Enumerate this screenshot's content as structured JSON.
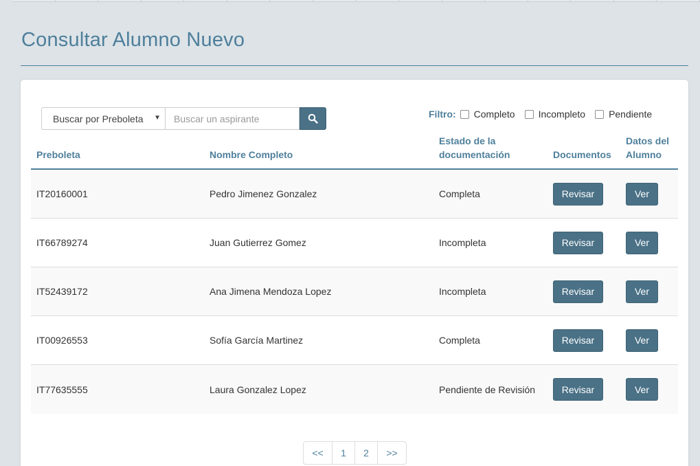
{
  "page": {
    "title": "Consultar Alumno Nuevo"
  },
  "search": {
    "select_value": "Buscar por Preboleta",
    "placeholder": "Buscar un aspirante",
    "button_icon": "search-icon"
  },
  "filter": {
    "label": "Filtro:",
    "options": [
      "Completo",
      "Incompleto",
      "Pendiente"
    ]
  },
  "table": {
    "headers": [
      "Preboleta",
      "Nombre Completo",
      "Estado de la documentación",
      "Documentos",
      "Datos del Alumno"
    ],
    "rows": [
      {
        "preboleta": "IT20160001",
        "nombre": "Pedro Jimenez Gonzalez",
        "estado": "Completa",
        "documentos": "Revisar",
        "datos": "Ver"
      },
      {
        "preboleta": "IT66789274",
        "nombre": "Juan Gutierrez Gomez",
        "estado": "Incompleta",
        "documentos": "Revisar",
        "datos": "Ver"
      },
      {
        "preboleta": "IT52439172",
        "nombre": "Ana Jimena Mendoza Lopez",
        "estado": "Incompleta",
        "documentos": "Revisar",
        "datos": "Ver"
      },
      {
        "preboleta": "IT00926553",
        "nombre": "Sofía García Martinez",
        "estado": "Completa",
        "documentos": "Revisar",
        "datos": "Ver"
      },
      {
        "preboleta": "IT77635555",
        "nombre": "Laura Gonzalez Lopez",
        "estado": "Pendiente de Revisión",
        "documentos": "Revisar",
        "datos": "Ver"
      }
    ]
  },
  "pagination": {
    "prev": "<<",
    "pages": [
      "1",
      "2"
    ],
    "next": ">>"
  },
  "colors": {
    "accent": "#4e7f9b",
    "button": "#4a7186",
    "background": "#dde3e7"
  }
}
